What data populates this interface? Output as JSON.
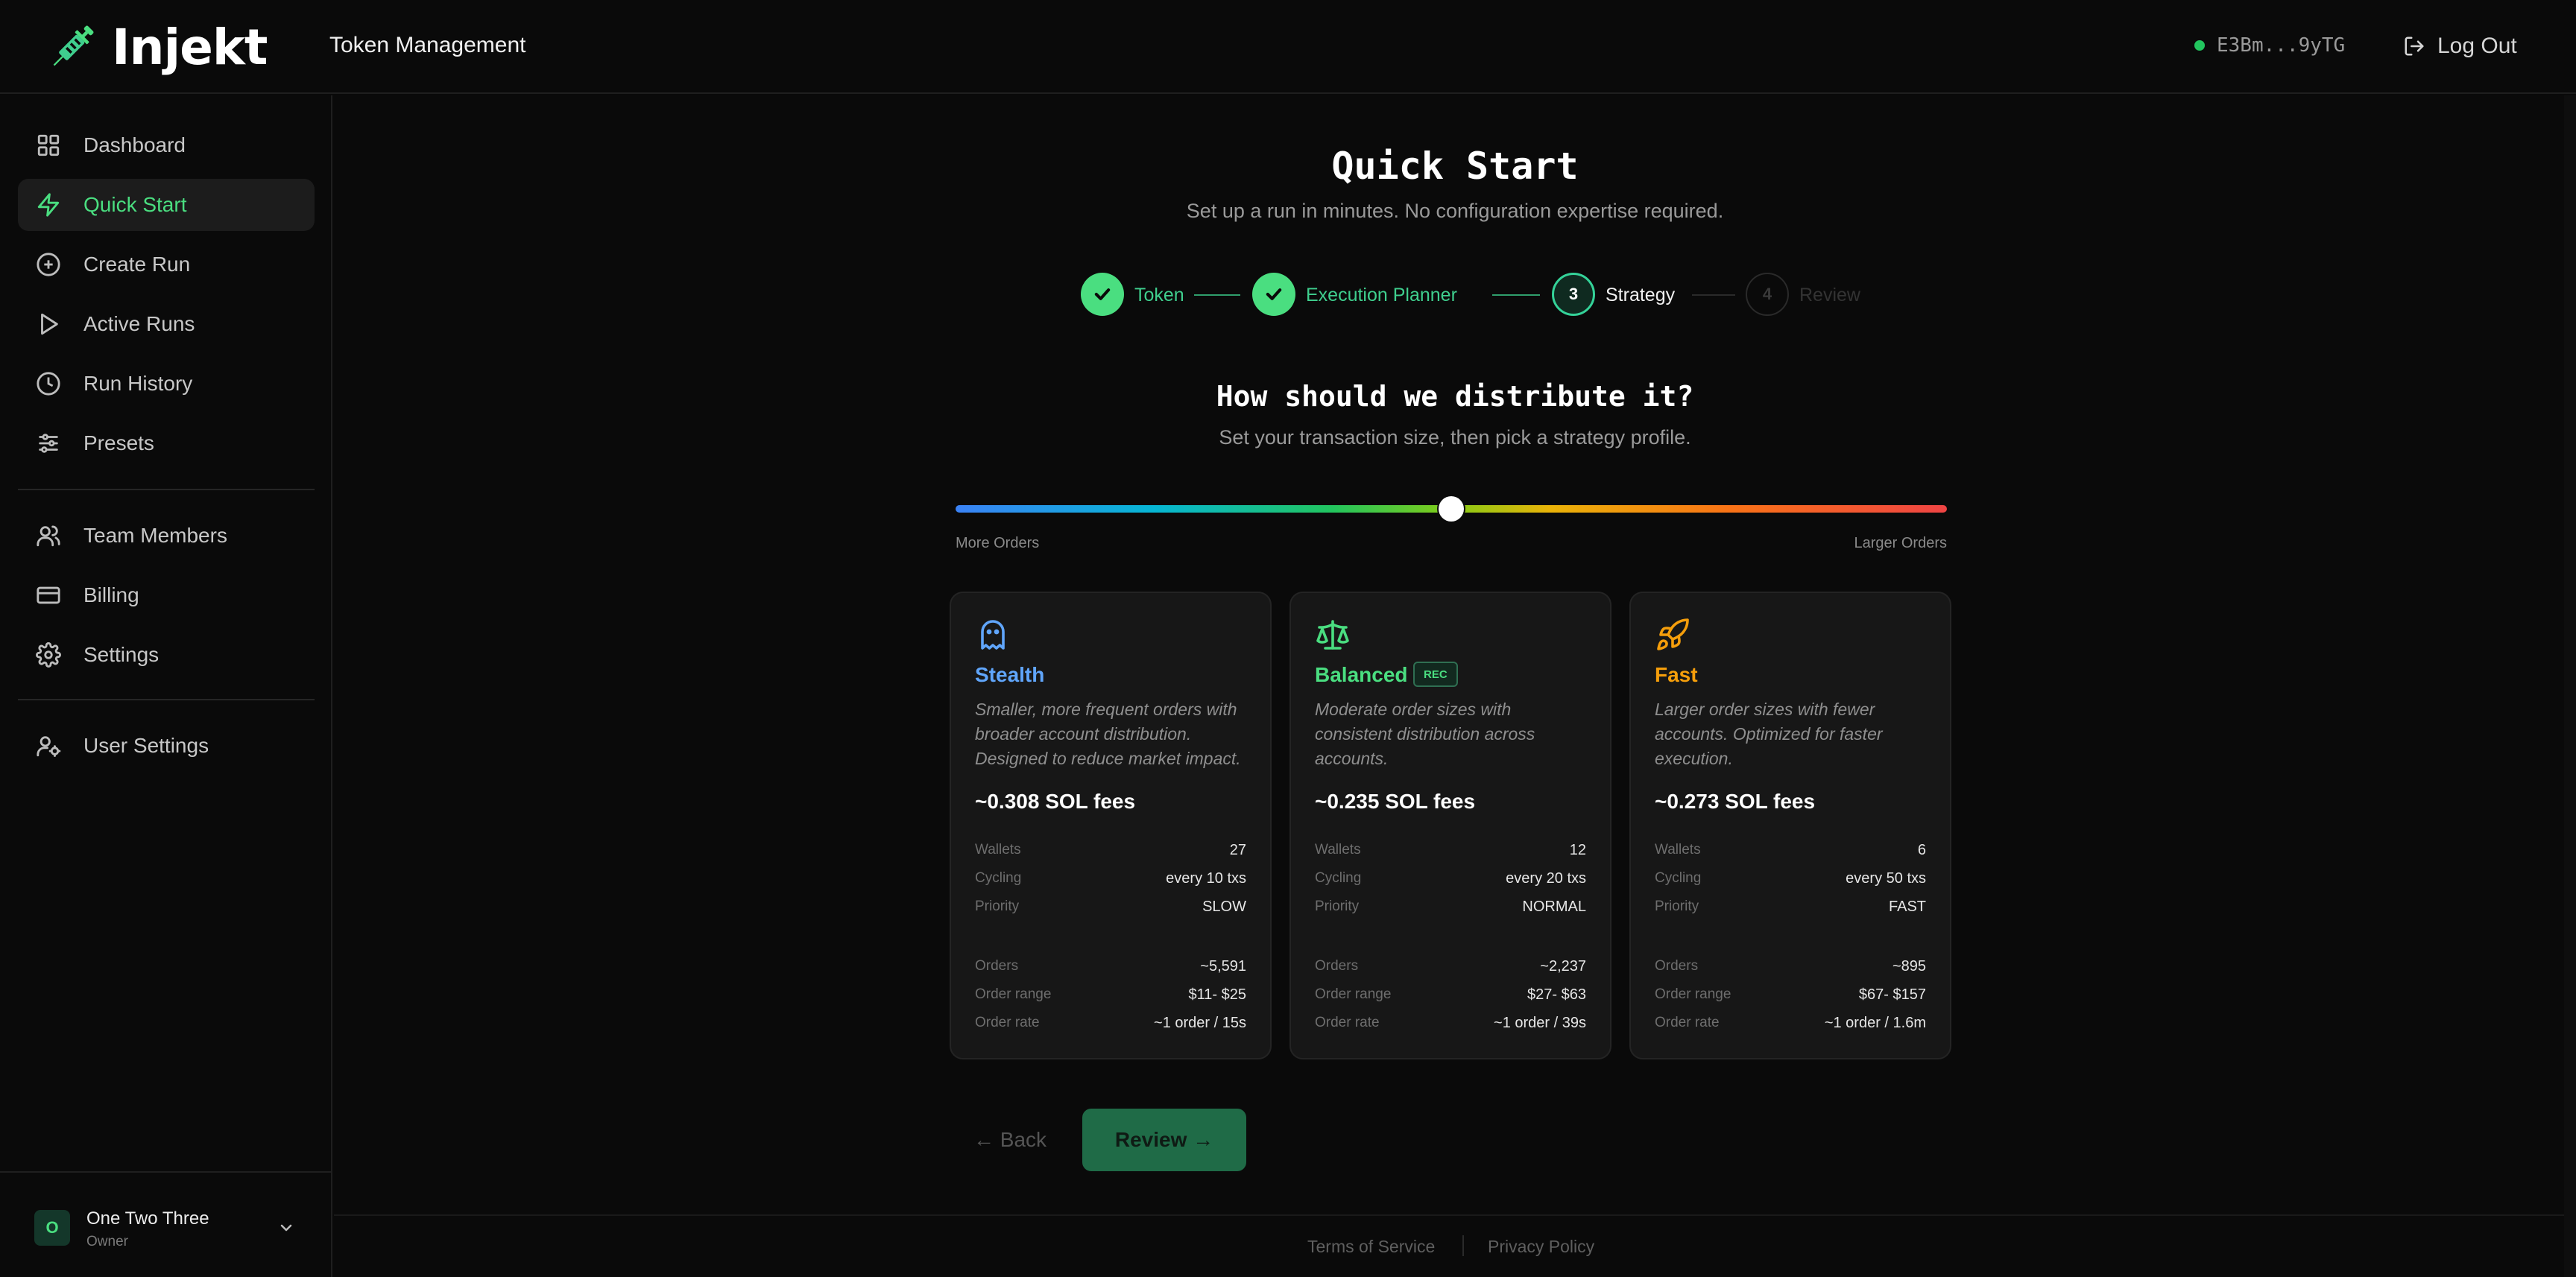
{
  "app": {
    "brand": "Injekt",
    "page_title": "Token Management"
  },
  "header": {
    "wallet": "E3Bm...9yTG",
    "logout_label": "Log Out",
    "status_color": "#22c55e"
  },
  "sidebar": {
    "items": [
      {
        "label": "Dashboard",
        "icon": "dashboard-icon"
      },
      {
        "label": "Quick Start",
        "icon": "lightning-icon",
        "active": true
      },
      {
        "label": "Create Run",
        "icon": "plus-circle-icon"
      },
      {
        "label": "Active Runs",
        "icon": "play-icon"
      },
      {
        "label": "Run History",
        "icon": "clock-icon"
      },
      {
        "label": "Presets",
        "icon": "sliders-icon"
      },
      {
        "label": "Team Members",
        "icon": "users-icon"
      },
      {
        "label": "Billing",
        "icon": "card-icon"
      },
      {
        "label": "Settings",
        "icon": "gear-icon"
      },
      {
        "label": "User Settings",
        "icon": "user-gear-icon"
      }
    ],
    "org": {
      "initial": "O",
      "name": "One Two Three",
      "role": "Owner"
    }
  },
  "main": {
    "title": "Quick Start",
    "subtitle": "Set up a run in minutes. No configuration expertise required.",
    "steps": [
      {
        "number": "1",
        "label": "Token",
        "state": "done"
      },
      {
        "number": "2",
        "label": "Execution Planner",
        "state": "done"
      },
      {
        "number": "3",
        "label": "Strategy",
        "state": "current"
      },
      {
        "number": "4",
        "label": "Review",
        "state": "todo"
      }
    ],
    "question": "How should we distribute it?",
    "question_sub": "Set your transaction size, then pick a strategy profile.",
    "slider": {
      "min_label": "More Orders",
      "max_label": "Larger Orders",
      "value": 0.5
    },
    "cards": [
      {
        "title": "Stealth",
        "color": "#60a5fa",
        "icon": "ghost-icon",
        "description": "Smaller, more frequent orders with broader account distribution. Designed to reduce market impact.",
        "fee": "~0.308 SOL fees",
        "rows": [
          {
            "k": "Wallets",
            "v": "27"
          },
          {
            "k": "Cycling",
            "v": "every 10 txs"
          },
          {
            "k": "Priority",
            "v": "SLOW"
          },
          {
            "k": "Orders",
            "v": "~5,591"
          },
          {
            "k": "Order range",
            "v": "$11- $25"
          },
          {
            "k": "Order rate",
            "v": "~1 order / 15s"
          }
        ]
      },
      {
        "title": "Balanced",
        "color": "#4ade80",
        "icon": "scale-icon",
        "badge": "REC",
        "description": "Moderate order sizes with consistent distribution across accounts.",
        "fee": "~0.235 SOL fees",
        "rows": [
          {
            "k": "Wallets",
            "v": "12"
          },
          {
            "k": "Cycling",
            "v": "every 20 txs"
          },
          {
            "k": "Priority",
            "v": "NORMAL"
          },
          {
            "k": "Orders",
            "v": "~2,237"
          },
          {
            "k": "Order range",
            "v": "$27- $63"
          },
          {
            "k": "Order rate",
            "v": "~1 order / 39s"
          }
        ]
      },
      {
        "title": "Fast",
        "color": "#f59e0b",
        "icon": "rocket-icon",
        "description": "Larger order sizes with fewer accounts. Optimized for faster execution.",
        "fee": "~0.273 SOL fees",
        "rows": [
          {
            "k": "Wallets",
            "v": "6"
          },
          {
            "k": "Cycling",
            "v": "every 50 txs"
          },
          {
            "k": "Priority",
            "v": "FAST"
          },
          {
            "k": "Orders",
            "v": "~895"
          },
          {
            "k": "Order range",
            "v": "$67- $157"
          },
          {
            "k": "Order rate",
            "v": "~1 order / 1.6m"
          }
        ]
      }
    ],
    "back_label": "← Back",
    "review_label": "Review →"
  },
  "footer": {
    "terms": "Terms of Service",
    "privacy": "Privacy Policy"
  }
}
